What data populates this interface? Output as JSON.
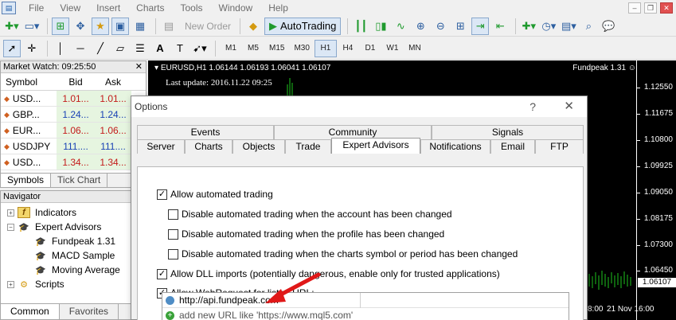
{
  "menubar": {
    "items": [
      "File",
      "View",
      "Insert",
      "Charts",
      "Tools",
      "Window",
      "Help"
    ]
  },
  "toolbar": {
    "new_order": "New Order",
    "autotrading": "AutoTrading",
    "timeframes": [
      "M1",
      "M5",
      "M15",
      "M30",
      "H1",
      "H4",
      "D1",
      "W1",
      "MN"
    ],
    "active_timeframe": "H1"
  },
  "market_watch": {
    "title": "Market Watch: 09:25:50",
    "columns": {
      "symbol": "Symbol",
      "bid": "Bid",
      "ask": "Ask"
    },
    "rows": [
      {
        "symbol": "USD...",
        "bid": "1.01...",
        "ask": "1.01..."
      },
      {
        "symbol": "GBP...",
        "bid": "1.24...",
        "ask": "1.24..."
      },
      {
        "symbol": "EUR...",
        "bid": "1.06...",
        "ask": "1.06..."
      },
      {
        "symbol": "USDJPY",
        "bid": "111....",
        "ask": "111...."
      },
      {
        "symbol": "USD...",
        "bid": "1.34...",
        "ask": "1.34..."
      }
    ],
    "tabs": [
      "Symbols",
      "Tick Chart"
    ]
  },
  "navigator": {
    "title": "Navigator",
    "items": {
      "indicators": "Indicators",
      "expert_advisors": "Expert Advisors",
      "fundpeak": "Fundpeak 1.31",
      "macd": "MACD Sample",
      "moving_average": "Moving Average",
      "scripts": "Scripts"
    },
    "tabs": [
      "Common",
      "Favorites"
    ]
  },
  "chart": {
    "title": "EURUSD,H1  1.06144 1.06193 1.06041 1.06107",
    "last_update": "Last update: 2016.11.22 09:25",
    "ea_name": "Fundpeak 1.31 ☺",
    "prices": [
      "1.12550",
      "1.11675",
      "1.10800",
      "1.09925",
      "1.09050",
      "1.08175",
      "1.07300",
      "1.06450"
    ],
    "current_price": "1.06107",
    "time_labels": [
      "8:00",
      "21 Nov 16:00"
    ]
  },
  "dialog": {
    "title": "Options",
    "help": "?",
    "close": "✕",
    "tabs_top": [
      "Events",
      "Community",
      "Signals"
    ],
    "tabs_bottom": [
      "Server",
      "Charts",
      "Objects",
      "Trade",
      "Expert Advisors",
      "Notifications",
      "Email",
      "FTP"
    ],
    "active_tab": "Expert Advisors",
    "options": {
      "allow_automated": "Allow automated trading",
      "disable_account": "Disable automated trading when the account has been changed",
      "disable_profile": "Disable automated trading when the profile has been changed",
      "disable_symbol": "Disable automated trading when the charts symbol or period has been changed",
      "allow_dll": "Allow DLL imports (potentially dangerous, enable only for trusted applications)",
      "allow_webrequest": "Allow WebRequest for listed URL:"
    },
    "url_list": {
      "entry": "http://api.fundpeak.com",
      "add_hint": "add new URL like 'https://www.mql5.com'"
    }
  }
}
